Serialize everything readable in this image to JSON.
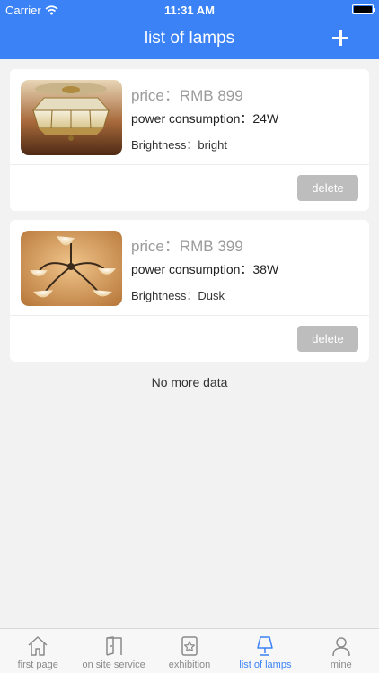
{
  "status_bar": {
    "carrier": "Carrier",
    "time": "11:31 AM"
  },
  "nav": {
    "title": "list of lamps"
  },
  "lamps": [
    {
      "price": "price：RMB 899",
      "power": "power consumption：24W",
      "brightness": "Brightness：bright",
      "delete_label": "delete"
    },
    {
      "price": "price：RMB 399",
      "power": "power consumption：38W",
      "brightness": "Brightness：Dusk",
      "delete_label": "delete"
    }
  ],
  "list_end": "No more data",
  "tabs": [
    {
      "label": "first page",
      "icon": "home-icon"
    },
    {
      "label": "on site service",
      "icon": "door-icon"
    },
    {
      "label": "exhibition",
      "icon": "exhibition-icon"
    },
    {
      "label": "list of lamps",
      "icon": "lamp-icon",
      "active": true
    },
    {
      "label": "mine",
      "icon": "person-icon"
    }
  ],
  "colors": {
    "accent": "#3b82f6",
    "delete_button": "#bdbdbd",
    "background": "#f2f2f2"
  }
}
